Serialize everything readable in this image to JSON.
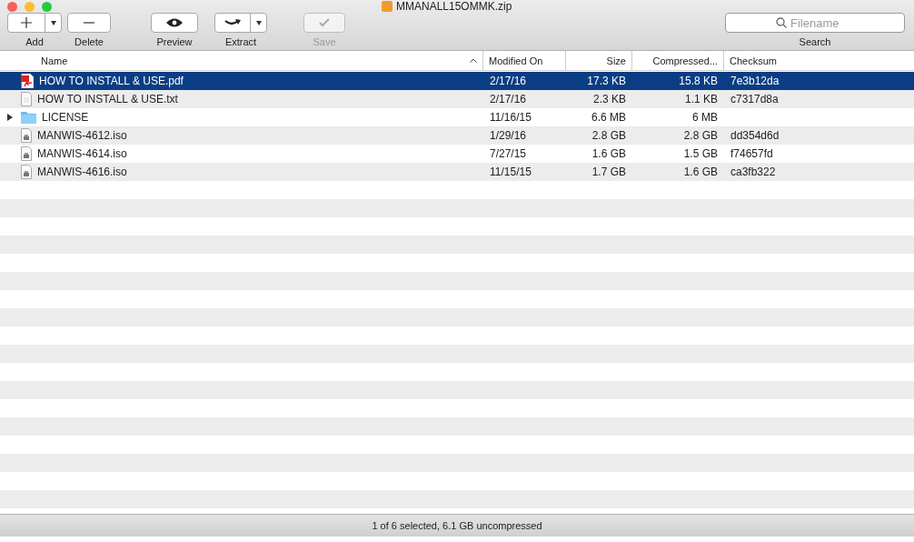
{
  "window": {
    "title": "MMANALL15OMMK.zip"
  },
  "toolbar": {
    "buttons": [
      {
        "label": "Add",
        "kind": "add",
        "disabled": false
      },
      {
        "label": "Delete",
        "kind": "delete",
        "disabled": false
      },
      {
        "label": "Preview",
        "kind": "preview",
        "disabled": false
      },
      {
        "label": "Extract",
        "kind": "extract",
        "disabled": false
      },
      {
        "label": "Save",
        "kind": "save",
        "disabled": true
      }
    ],
    "search": {
      "placeholder": "Filename",
      "label": "Search"
    }
  },
  "table": {
    "columns": [
      {
        "label": "Name",
        "sorted": true
      },
      {
        "label": "Modified On",
        "sorted": false
      },
      {
        "label": "Size",
        "sorted": false
      },
      {
        "label": "Compressed...",
        "sorted": false
      },
      {
        "label": "Checksum",
        "sorted": false
      }
    ],
    "rows": [
      {
        "kind": "pdf",
        "name": "HOW TO INSTALL & USE.pdf",
        "modified": "2/17/16",
        "size": "17.3 KB",
        "compressed": "15.8 KB",
        "checksum": "7e3b12da",
        "selected": true
      },
      {
        "kind": "text",
        "name": "HOW TO INSTALL & USE.txt",
        "modified": "2/17/16",
        "size": "2.3 KB",
        "compressed": "1.1 KB",
        "checksum": "c7317d8a",
        "selected": false
      },
      {
        "kind": "folder",
        "name": "LICENSE",
        "modified": "11/16/15",
        "size": "6.6 MB",
        "compressed": "6 MB",
        "expanded": false,
        "selected": false
      },
      {
        "kind": "disk",
        "name": "MANWIS-4612.iso",
        "modified": "1/29/16",
        "size": "2.8 GB",
        "compressed": "2.8 GB",
        "checksum": "dd354d6d",
        "selected": false
      },
      {
        "kind": "disk",
        "name": "MANWIS-4614.iso",
        "modified": "7/27/15",
        "size": "1.6 GB",
        "compressed": "1.5 GB",
        "checksum": "f74657fd",
        "selected": false
      },
      {
        "kind": "disk",
        "name": "MANWIS-4616.iso",
        "modified": "11/15/15",
        "size": "1.7 GB",
        "compressed": "1.6 GB",
        "checksum": "ca3fb322",
        "selected": false
      }
    ]
  },
  "status_bar": "1 of 6 selected, 6.1 GB uncompressed"
}
